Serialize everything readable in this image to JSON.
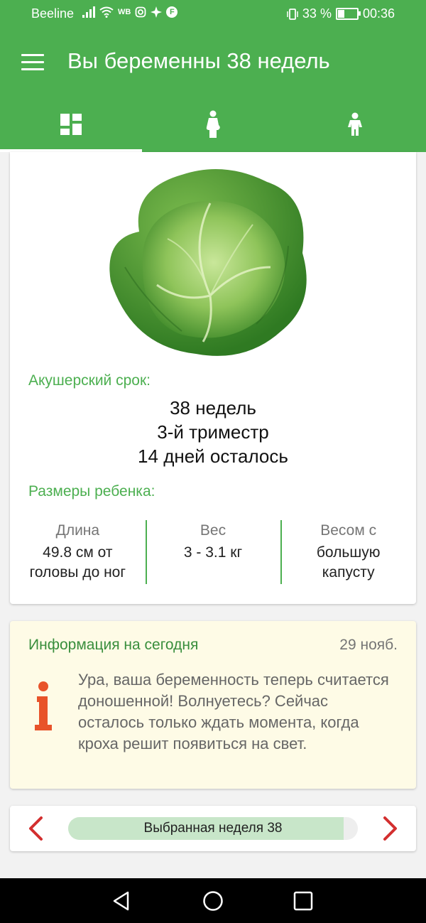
{
  "status_bar": {
    "carrier": "Beeline",
    "wb_label": "WB",
    "f_label": "F",
    "battery": "33 %",
    "time": "00:36"
  },
  "toolbar": {
    "title": "Вы беременны 38 недель"
  },
  "tabs": [
    {
      "icon": "dashboard-icon",
      "active": true
    },
    {
      "icon": "pregnant-woman-icon",
      "active": false
    },
    {
      "icon": "child-icon",
      "active": false
    }
  ],
  "baby_card": {
    "image": "cabbage-image",
    "term_label": "Акушерский срок:",
    "weeks": "38 недель",
    "trimester": "3-й триместр",
    "days_left": "14 дней осталось",
    "sizes_label": "Размеры ребенка:",
    "length": {
      "header": "Длина",
      "value": "49.8 см от головы до ног"
    },
    "weight": {
      "header": "Вес",
      "value": "3 - 3.1 кг"
    },
    "comparison": {
      "header": "Весом с",
      "value": "большую капусту"
    }
  },
  "info_card": {
    "title": "Информация на сегодня",
    "date": "29 нояб.",
    "icon": "info-icon",
    "text": "Ура, ваша беременность теперь считается доношенной! Волнуетесь? Сейчас осталось только ждать момента, когда кроха решит появиться на свет."
  },
  "week_selector": {
    "label": "Выбранная неделя 38",
    "progress": 0.95
  },
  "colors": {
    "primary": "#4caf50",
    "accent_red": "#e53935",
    "info_bg": "#fefbe6",
    "progress_fill": "#c8e6c9"
  }
}
